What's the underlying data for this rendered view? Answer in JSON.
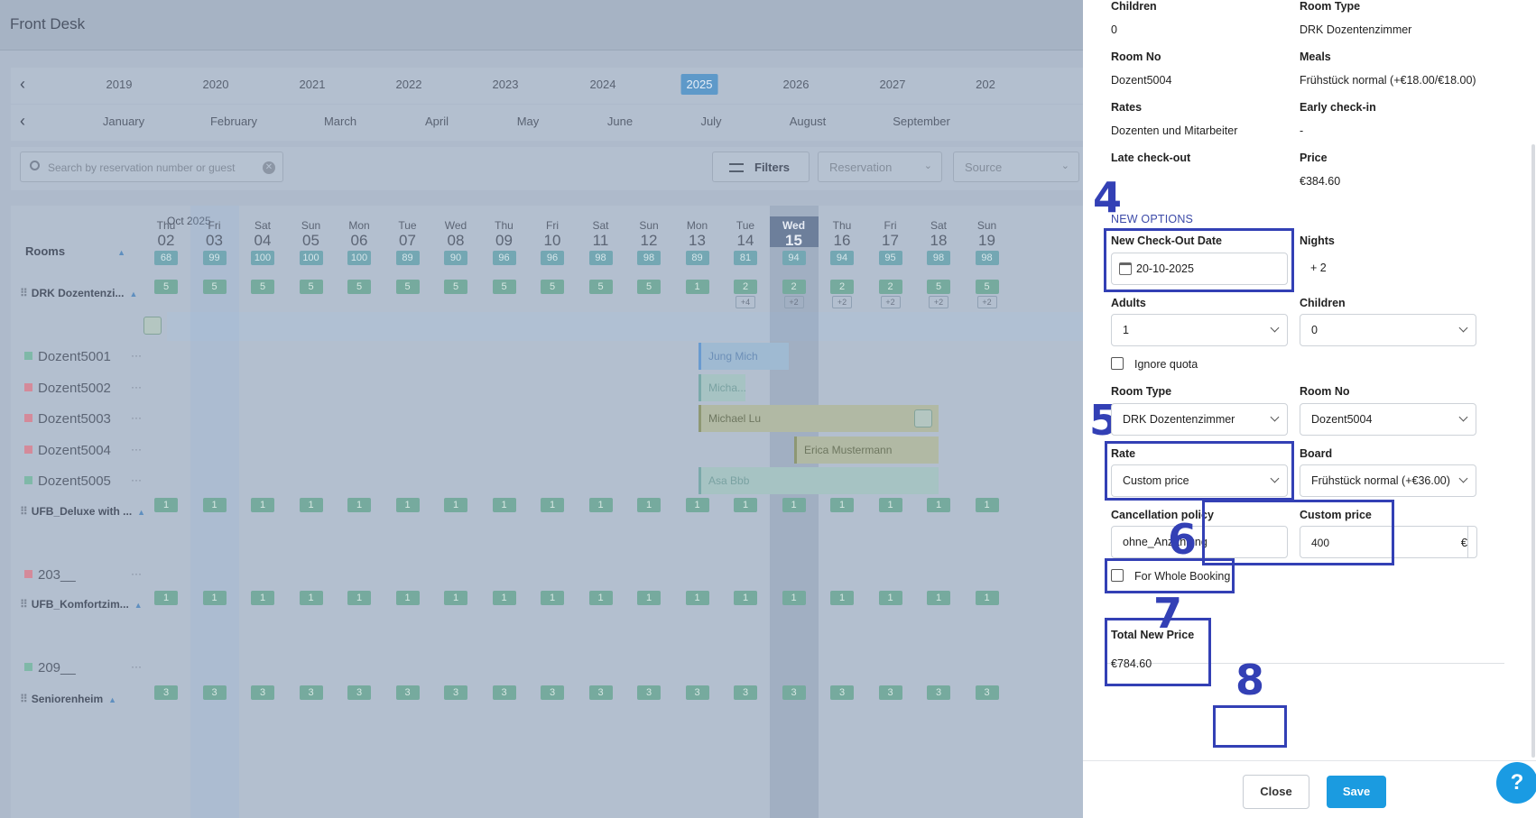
{
  "app": {
    "title": "Front Desk"
  },
  "years": [
    "2019",
    "2020",
    "2021",
    "2022",
    "2023",
    "2024",
    "2025",
    "2026",
    "2027",
    "202"
  ],
  "selected_year": "2025",
  "months": [
    "January",
    "February",
    "March",
    "April",
    "May",
    "June",
    "July",
    "August",
    "September"
  ],
  "search": {
    "placeholder": "Search by reservation number or guest",
    "filters_label": "Filters",
    "reservation_placeholder": "Reservation",
    "source_placeholder": "Source"
  },
  "calendar": {
    "month_label": "Oct 2025",
    "rooms_header": "Rooms",
    "days": [
      {
        "dow": "Thu",
        "d": "02",
        "occ": "68"
      },
      {
        "dow": "Fri",
        "d": "03",
        "occ": "99"
      },
      {
        "dow": "Sat",
        "d": "04",
        "occ": "100"
      },
      {
        "dow": "Sun",
        "d": "05",
        "occ": "100"
      },
      {
        "dow": "Mon",
        "d": "06",
        "occ": "100"
      },
      {
        "dow": "Tue",
        "d": "07",
        "occ": "89"
      },
      {
        "dow": "Wed",
        "d": "08",
        "occ": "90"
      },
      {
        "dow": "Thu",
        "d": "09",
        "occ": "96"
      },
      {
        "dow": "Fri",
        "d": "10",
        "occ": "96"
      },
      {
        "dow": "Sat",
        "d": "11",
        "occ": "98"
      },
      {
        "dow": "Sun",
        "d": "12",
        "occ": "98"
      },
      {
        "dow": "Mon",
        "d": "13",
        "occ": "89"
      },
      {
        "dow": "Tue",
        "d": "14",
        "occ": "81"
      },
      {
        "dow": "Wed",
        "d": "15",
        "occ": "94"
      },
      {
        "dow": "Thu",
        "d": "16",
        "occ": "94"
      },
      {
        "dow": "Fri",
        "d": "17",
        "occ": "95"
      },
      {
        "dow": "Sat",
        "d": "18",
        "occ": "98"
      },
      {
        "dow": "Sun",
        "d": "19",
        "occ": "98"
      }
    ],
    "room_types": [
      {
        "name": "DRK Dozentenzi...",
        "avail": [
          "5",
          "5",
          "5",
          "5",
          "5",
          "5",
          "5",
          "5",
          "5",
          "5",
          "5",
          "1",
          "2",
          "2",
          "2",
          "2",
          "5",
          "5"
        ],
        "sub": [
          "",
          "",
          "",
          "",
          "",
          "",
          "",
          "",
          "",
          "",
          "",
          "",
          "+4",
          "+2",
          "+2",
          "+2",
          "+2",
          "+2"
        ]
      },
      {
        "name": "UFB_Deluxe with ...",
        "avail": [
          "1",
          "1",
          "1",
          "1",
          "1",
          "1",
          "1",
          "1",
          "1",
          "1",
          "1",
          "1",
          "1",
          "1",
          "1",
          "1",
          "1",
          "1"
        ]
      },
      {
        "name": "UFB_Komfortzim...",
        "avail": [
          "1",
          "1",
          "1",
          "1",
          "1",
          "1",
          "1",
          "1",
          "1",
          "1",
          "1",
          "1",
          "1",
          "1",
          "1",
          "1",
          "1",
          "1"
        ]
      },
      {
        "name": "Seniorenheim",
        "avail": [
          "3",
          "3",
          "3",
          "3",
          "3",
          "3",
          "3",
          "3",
          "3",
          "3",
          "3",
          "3",
          "3",
          "3",
          "3",
          "3",
          "3",
          "3"
        ]
      }
    ],
    "rooms": [
      {
        "name": "Dozent5001",
        "status": "#7fb8a8"
      },
      {
        "name": "Dozent5002",
        "status": "#d48a9a"
      },
      {
        "name": "Dozent5003",
        "status": "#d48a9a"
      },
      {
        "name": "Dozent5004",
        "status": "#d48a9a"
      },
      {
        "name": "Dozent5005",
        "status": "#7fb8a8"
      },
      {
        "name": "203__",
        "status": "#d48a9a"
      },
      {
        "name": "209__",
        "status": "#7fb8a8"
      }
    ],
    "bookings": [
      "Jung Mich",
      "Micha...",
      "Michael Lu",
      "Erica Mustermann",
      "Asa Bbb"
    ]
  },
  "panel": {
    "children_label": "Children",
    "children_value": "0",
    "room_type_label": "Room Type",
    "room_type_value": "DRK Dozentenzimmer",
    "room_no_label": "Room No",
    "room_no_value": "Dozent5004",
    "meals_label": "Meals",
    "meals_value": "Frühstück normal (+€18.00/€18.00)",
    "rates_label": "Rates",
    "rates_value": "Dozenten und Mitarbeiter",
    "early_label": "Early check-in",
    "early_value": "-",
    "late_label": "Late check-out",
    "price_label": "Price",
    "price_value": "€384.60",
    "new_options": "NEW OPTIONS",
    "checkout_label": "New Check-Out Date",
    "checkout_value": "20-10-2025",
    "nights_label": "Nights",
    "nights_value": "+ 2",
    "adults_label": "Adults",
    "adults_value": "1",
    "children2_label": "Children",
    "children2_value": "0",
    "ignore_quota": "Ignore quota",
    "room_type2_label": "Room Type",
    "room_type2_value": "DRK Dozentenzimmer",
    "room_no2_label": "Room No",
    "room_no2_value": "Dozent5004",
    "rate_label": "Rate",
    "rate_value": "Custom price",
    "board_label": "Board",
    "board_value": "Frühstück normal (+€36.00)",
    "cancel_label": "Cancellation policy",
    "cancel_value": "ohne_Anzahlung",
    "custom_price_label": "Custom price",
    "custom_price_value": "400",
    "currency": "€",
    "whole_booking": "For Whole Booking",
    "total_label": "Total New Price",
    "total_value": "€784.60",
    "close_label": "Close",
    "save_label": "Save"
  },
  "annotations": {
    "n4": "4",
    "n5": "5",
    "n6": "6",
    "n7": "7",
    "n8": "8",
    "color": "#3340b5"
  },
  "help_label": "?"
}
